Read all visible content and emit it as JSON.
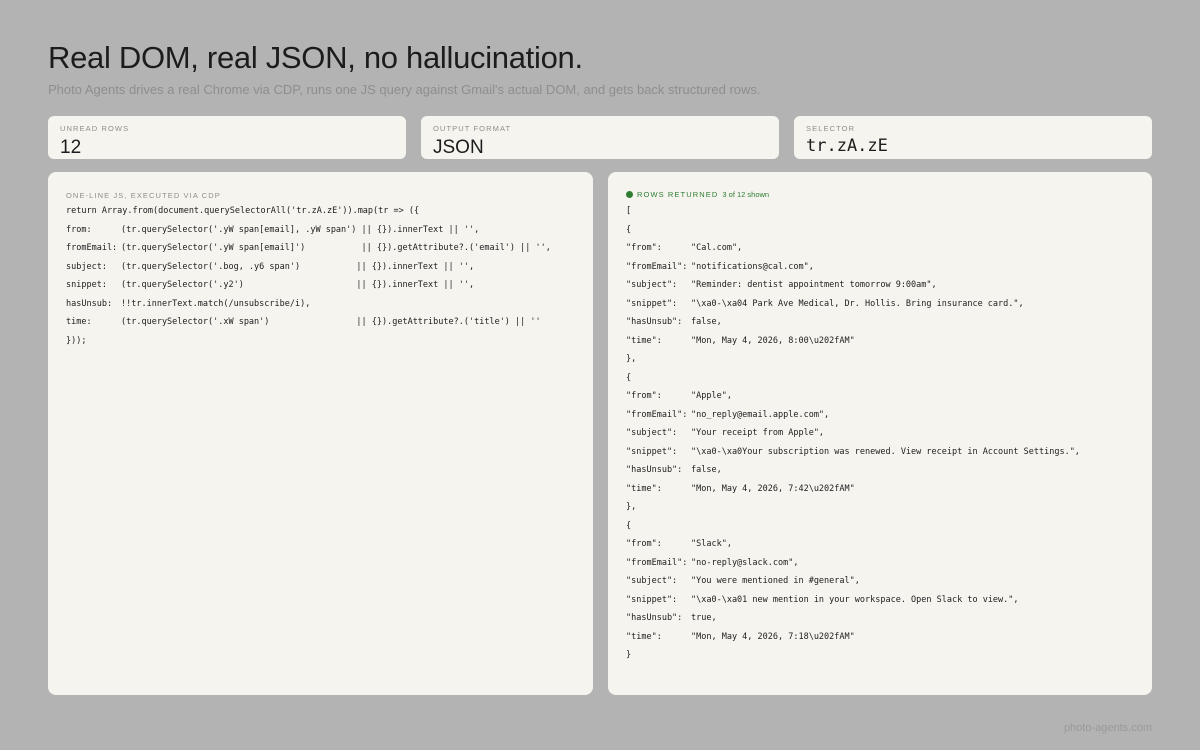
{
  "header": {
    "title": "Real DOM, real JSON, no hallucination.",
    "subtitle": "Photo Agents drives a real Chrome via CDP, runs one JS query against Gmail's actual DOM, and gets back structured rows."
  },
  "stats": [
    {
      "label": "UNREAD ROWS",
      "value": "12"
    },
    {
      "label": "OUTPUT FORMAT",
      "value": "JSON"
    },
    {
      "label": "SELECTOR",
      "value": "tr.zA.zE"
    }
  ],
  "query_panel": {
    "label": "ONE-LINE JS, EXECUTED VIA CDP",
    "lines": [
      {
        "k": "",
        "v": "return Array.from(document.querySelectorAll('tr.zA.zE')).map(tr => ({"
      },
      {
        "k": "from:",
        "v": "(tr.querySelector('.yW span[email], .yW span') || {}).innerText || '',"
      },
      {
        "k": "fromEmail:",
        "v": "(tr.querySelector('.yW span[email]')           || {}).getAttribute?.('email') || '',"
      },
      {
        "k": "subject:",
        "v": "(tr.querySelector('.bog, .y6 span')           || {}).innerText || '',"
      },
      {
        "k": "snippet:",
        "v": "(tr.querySelector('.y2')                      || {}).innerText || '',"
      },
      {
        "k": "hasUnsub:",
        "v": "!!tr.innerText.match(/unsubscribe/i),"
      },
      {
        "k": "time:",
        "v": "(tr.querySelector('.xW span')                 || {}).getAttribute?.('title') || ''"
      },
      {
        "k": "",
        "v": "}));"
      }
    ]
  },
  "result_panel": {
    "label": "ROWS RETURNED",
    "count": "3 of 12 shown",
    "status_color": "#2e7d32",
    "lines": [
      {
        "k": "",
        "v": "["
      },
      {
        "k": "",
        "v": "{"
      },
      {
        "k": "\"from\":",
        "v": "\"Cal.com\","
      },
      {
        "k": "\"fromEmail\":",
        "v": "\"notifications@cal.com\","
      },
      {
        "k": "\"subject\":",
        "v": "\"Reminder: dentist appointment tomorrow 9:00am\","
      },
      {
        "k": "\"snippet\":",
        "v": "\"\\xa0-\\xa04 Park Ave Medical, Dr. Hollis. Bring insurance card.\","
      },
      {
        "k": "\"hasUnsub\":",
        "v": "false,"
      },
      {
        "k": "\"time\":",
        "v": "\"Mon, May 4, 2026, 8:00\\u202fAM\""
      },
      {
        "k": "",
        "v": "},"
      },
      {
        "k": "",
        "v": "{"
      },
      {
        "k": "\"from\":",
        "v": "\"Apple\","
      },
      {
        "k": "\"fromEmail\":",
        "v": "\"no_reply@email.apple.com\","
      },
      {
        "k": "\"subject\":",
        "v": "\"Your receipt from Apple\","
      },
      {
        "k": "\"snippet\":",
        "v": "\"\\xa0-\\xa0Your subscription was renewed. View receipt in Account Settings.\","
      },
      {
        "k": "\"hasUnsub\":",
        "v": "false,"
      },
      {
        "k": "\"time\":",
        "v": "\"Mon, May 4, 2026, 7:42\\u202fAM\""
      },
      {
        "k": "",
        "v": "},"
      },
      {
        "k": "",
        "v": "{"
      },
      {
        "k": "\"from\":",
        "v": "\"Slack\","
      },
      {
        "k": "\"fromEmail\":",
        "v": "\"no-reply@slack.com\","
      },
      {
        "k": "\"subject\":",
        "v": "\"You were mentioned in #general\","
      },
      {
        "k": "\"snippet\":",
        "v": "\"\\xa0-\\xa01 new mention in your workspace. Open Slack to view.\","
      },
      {
        "k": "\"hasUnsub\":",
        "v": "true,"
      },
      {
        "k": "\"time\":",
        "v": "\"Mon, May 4, 2026, 7:18\\u202fAM\""
      },
      {
        "k": "",
        "v": "}"
      }
    ]
  },
  "footer": {
    "text": "photo-agents.com"
  }
}
